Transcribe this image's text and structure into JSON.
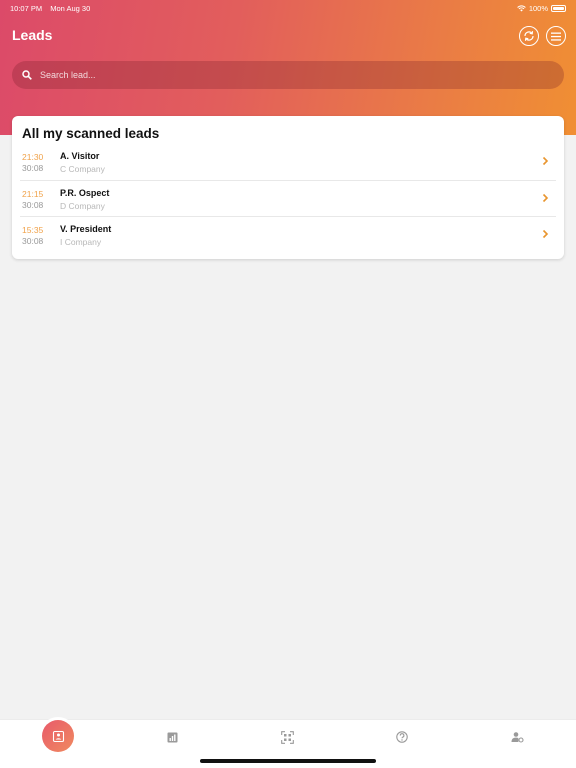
{
  "status": {
    "time": "10:07 PM",
    "date": "Mon Aug 30",
    "battery": "100%"
  },
  "header": {
    "title": "Leads"
  },
  "search": {
    "placeholder": "Search lead..."
  },
  "card": {
    "title": "All my scanned leads",
    "leads": [
      {
        "time": "21:30",
        "duration": "30:08",
        "name": "A. Visitor",
        "company": "C Company"
      },
      {
        "time": "21:15",
        "duration": "30:08",
        "name": "P.R. Ospect",
        "company": "D Company"
      },
      {
        "time": "15:35",
        "duration": "30:08",
        "name": "V. President",
        "company": "I Company"
      }
    ]
  },
  "tabs": [
    {
      "icon": "leads-contact-icon",
      "active": true
    },
    {
      "icon": "stats-chart-icon",
      "active": false
    },
    {
      "icon": "qr-scan-icon",
      "active": false
    },
    {
      "icon": "help-circle-icon",
      "active": false
    },
    {
      "icon": "account-settings-icon",
      "active": false
    }
  ],
  "colors": {
    "accent": "#f0a24a",
    "gradient_start": "#dc4a69",
    "gradient_end": "#f08f33"
  }
}
